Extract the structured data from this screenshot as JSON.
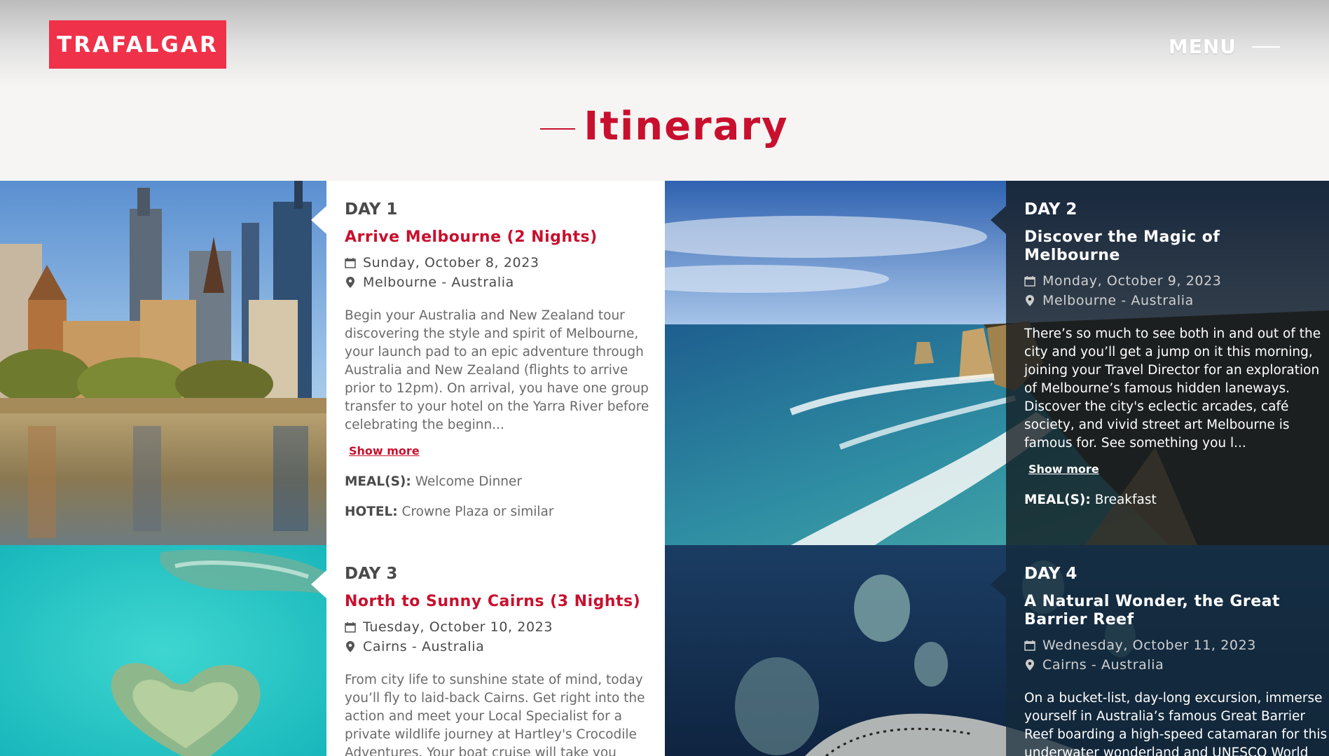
{
  "header": {
    "logo_text": "TRAFALGAR",
    "menu_label": "MENU"
  },
  "section": {
    "title": "Itinerary"
  },
  "days": [
    {
      "day_label": "DAY 1",
      "title": "Arrive Melbourne (2 Nights)",
      "date": "Sunday, October 8, 2023",
      "location": "Melbourne - Australia",
      "description": "Begin your Australia and New Zealand tour discovering the style and spirit of Melbourne, your launch pad to an epic adventure through Australia and New Zealand (flights to arrive prior to 12pm). On arrival, you have one group transfer to your hotel on the Yarra River before celebrating the beginn...",
      "show_more": "Show more",
      "meals_label": "MEAL(S):",
      "meals_value": "Welcome Dinner",
      "hotel_label": "HOTEL:",
      "hotel_value": "Crowne Plaza or similar"
    },
    {
      "day_label": "DAY 2",
      "title": "Discover the Magic of Melbourne",
      "date": "Monday, October 9, 2023",
      "location": "Melbourne - Australia",
      "description": "There’s so much to see both in and out of the city and you’ll get a jump on it this morning, joining your Travel Director for an exploration of Melbourne’s famous hidden laneways. Discover the city's eclectic arcades, café society, and vivid street art Melbourne is famous for. See something you l...",
      "show_more": "Show more",
      "meals_label": "MEAL(S):",
      "meals_value": "Breakfast"
    },
    {
      "day_label": "DAY 3",
      "title": "North to Sunny Cairns (3 Nights)",
      "date": "Tuesday, October 10, 2023",
      "location": "Cairns - Australia",
      "description": "From city life to sunshine state of mind, today you’ll fly to laid-back Cairns. Get right into the action and meet your Local Specialist for a private wildlife journey at Hartley's Crocodile Adventures. Your boat cruise will take you through the"
    },
    {
      "day_label": "DAY 4",
      "title": "A Natural Wonder, the Great Barrier Reef",
      "date": "Wednesday, October 11, 2023",
      "location": "Cairns - Australia",
      "description": "On a bucket-list, day-long excursion, immerse yourself in Australia’s famous Great Barrier Reef boarding a high-speed catamaran for this underwater wonderland and UNESCO World"
    }
  ],
  "icons": {
    "calendar": "calendar-icon",
    "location": "map-pin-icon",
    "menu": "hamburger-line-icon"
  },
  "colors": {
    "brand_red": "#ef3149",
    "title_red": "#c8102e"
  }
}
